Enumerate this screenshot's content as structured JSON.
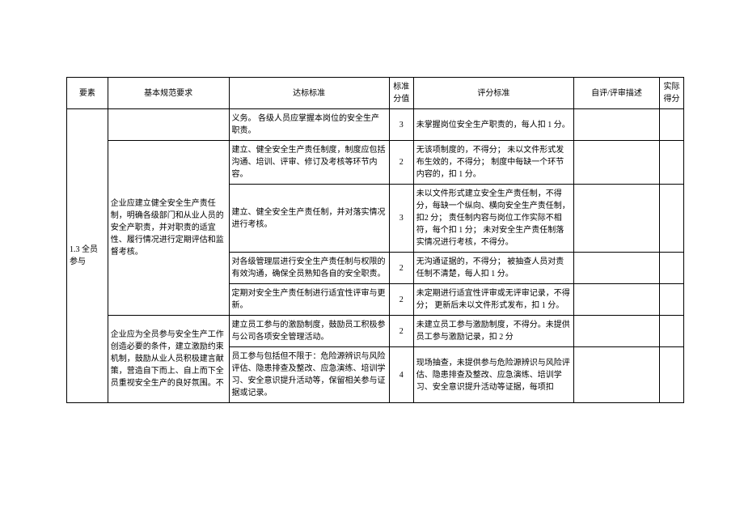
{
  "headers": {
    "element": "要素",
    "basic": "基本规范要求",
    "standard": "达标标准",
    "score": "标准分值",
    "criteria": "评分标准",
    "review": "自评/评审描述",
    "actual": "实际得分"
  },
  "rows": [
    {
      "element": "1.3 全员参与",
      "basic_groups": [
        {
          "basic": "",
          "sub": [
            {
              "standard": "义务。\n各级人员应掌握本岗位的安全生产职责。",
              "score": "3",
              "criteria": "未掌握岗位安全生产职责的，每人扣 1 分。"
            }
          ]
        },
        {
          "basic": "企业应建立健全安全生产责任制，明确各级部门和从业人员的安全产职责，并对职责的适宜性、履行情况进行定期评估和监督考核。",
          "sub": [
            {
              "standard": "建立、健全安全生产责任制度，制度应包括沟通、培训、评审、修订及考核等环节内容。",
              "score": "2",
              "criteria": "无该项制度的，不得分；\n未以文件形式发布生效的，不得分；\n制度中每缺一个环节内容的，扣 1 分。"
            },
            {
              "standard": "建立、健全安全生产责任制，并对落实情况进行考核。",
              "score": "3",
              "criteria": "未以文件形式建立安全生产责任制，不得分，每缺一个纵向、横向安全生产责任制，扣2 分；\n责任制内容与岗位工作实际不相符，每个扣 1 分；\n未对安全生产责任制落实情况进行考核，不得分。"
            },
            {
              "standard": "对各级管理层进行安全生产责任制与权限的有效沟通，确保全员熟知各自的安全职责。",
              "score": "2",
              "criteria": "无沟通证据的，不得分；\n被抽查人员对责任制不清楚，每人扣 1 分。"
            },
            {
              "standard": "定期对安全生产责任制进行适宜性评审与更新。",
              "score": "2",
              "criteria": "未定期进行适宜性评审或无评审记录，不得分；\n更新后未以文件形式发布，扣 1 分。"
            }
          ]
        },
        {
          "basic": "企业应为全员参与安全生产工作创造必要的条件，建立激励约束机制，鼓励从业人员积极建言献策，营造自下而上、自上而下全员重视安全生产的良好氛围。不",
          "sub": [
            {
              "standard": "建立员工参与的激励制度，鼓励员工积极参与公司各项安全管理活动。",
              "score": "2",
              "criteria": "未建立员工参与激励制度，不得分。未提供员工参与激励记录，扣 2 分"
            },
            {
              "standard": "员工参与包括但不限于：危险源辨识与风险评估、隐患排查及整改、应急演练、培训学习、安全意识提升活动等，保留相关参与证据或记录。",
              "score": "4",
              "criteria": "现场抽查，未提供参与危险源辨识与风险评估、隐患排查及整改、应急演练、培训学习、安全意识提升活动等证据，每项扣"
            }
          ]
        }
      ]
    }
  ]
}
